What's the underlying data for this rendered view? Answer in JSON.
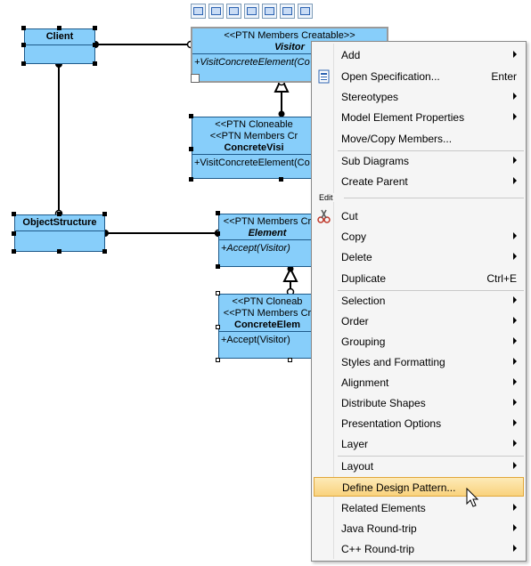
{
  "diagram": {
    "toolbar_icons": [
      "copy-icon",
      "arrange-icon",
      "link-icon",
      "resize-icon",
      "connect-icon",
      "style-icon",
      "3d-box-icon"
    ],
    "classes": {
      "client": {
        "name": "Client"
      },
      "visitor": {
        "stereotype": "<<PTN Members Creatable>>",
        "name": "Visitor",
        "operation": "+VisitConcreteElement(Co"
      },
      "concrete_visitor": {
        "stereotype1": "<<PTN Cloneable",
        "stereotype2": "<<PTN Members Cr",
        "name": "ConcreteVisi",
        "operation": "+VisitConcreteElement(Co"
      },
      "object_structure": {
        "name": "ObjectStructure"
      },
      "element": {
        "stereotype": "<<PTN Members Cr",
        "name": "Element",
        "operation": "+Accept(Visitor)"
      },
      "concrete_element": {
        "stereotype1": "<<PTN Cloneab",
        "stereotype2": "<<PTN Members Cr",
        "name": "ConcreteElem",
        "operation": "+Accept(Visitor)"
      }
    }
  },
  "context_menu": {
    "group_edit_label": "Edit",
    "items": [
      {
        "label": "Add",
        "submenu": true
      },
      {
        "label": "Open Specification...",
        "shortcut": "Enter",
        "icon": "specification-icon"
      },
      {
        "label": "Stereotypes",
        "submenu": true
      },
      {
        "label": "Model Element Properties",
        "submenu": true
      },
      {
        "label": "Move/Copy Members..."
      },
      {
        "label": "Sub Diagrams",
        "submenu": true
      },
      {
        "label": "Create Parent",
        "submenu": true
      },
      {
        "label": "Cut",
        "icon": "scissors-icon"
      },
      {
        "label": "Copy",
        "submenu": true
      },
      {
        "label": "Delete",
        "submenu": true
      },
      {
        "label": "Duplicate",
        "shortcut": "Ctrl+E"
      },
      {
        "label": "Selection",
        "submenu": true
      },
      {
        "label": "Order",
        "submenu": true
      },
      {
        "label": "Grouping",
        "submenu": true
      },
      {
        "label": "Styles and Formatting",
        "submenu": true
      },
      {
        "label": "Alignment",
        "submenu": true
      },
      {
        "label": "Distribute Shapes",
        "submenu": true
      },
      {
        "label": "Presentation Options",
        "submenu": true
      },
      {
        "label": "Layer",
        "submenu": true
      },
      {
        "label": "Layout",
        "submenu": true
      },
      {
        "label": "Define Design Pattern...",
        "highlighted": true
      },
      {
        "label": "Related Elements",
        "submenu": true
      },
      {
        "label": "Java Round-trip",
        "submenu": true
      },
      {
        "label": "C++ Round-trip",
        "submenu": true
      }
    ]
  },
  "colors": {
    "class_fill": "#87cefa",
    "class_border": "#1e5a8a",
    "highlight": "#f9d27d",
    "menu_bg": "#f5f5f5"
  }
}
